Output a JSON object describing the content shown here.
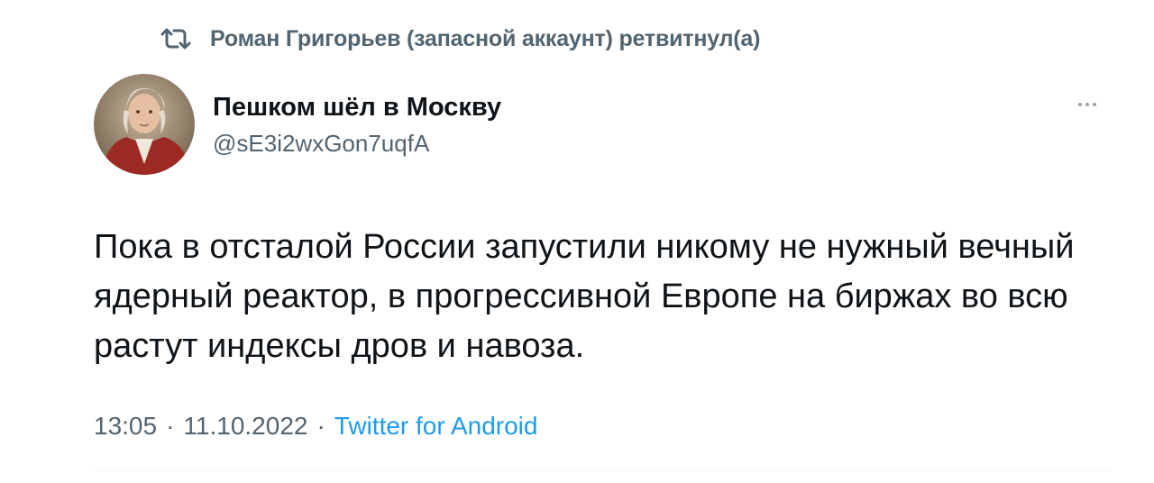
{
  "retweet": {
    "text": "Роман Григорьев (запасной аккаунт) ретвитнул(а)",
    "icon": "retweet-icon"
  },
  "author": {
    "display_name": "Пешком шёл в Москву",
    "handle": "@sE3i2wxGon7uqfA",
    "avatar": "avatar-portrait"
  },
  "tweet": {
    "text": "Пока в отсталой России запустили никому не нужный вечный ядерный реактор, в прогрессивной Европе на биржах во всю растут индексы дров и навоза."
  },
  "meta": {
    "time": "13:05",
    "separator": "·",
    "date": "11.10.2022",
    "source": "Twitter for Android"
  },
  "colors": {
    "text_primary": "#0f1419",
    "text_secondary": "#536471",
    "link": "#1d9bf0"
  }
}
